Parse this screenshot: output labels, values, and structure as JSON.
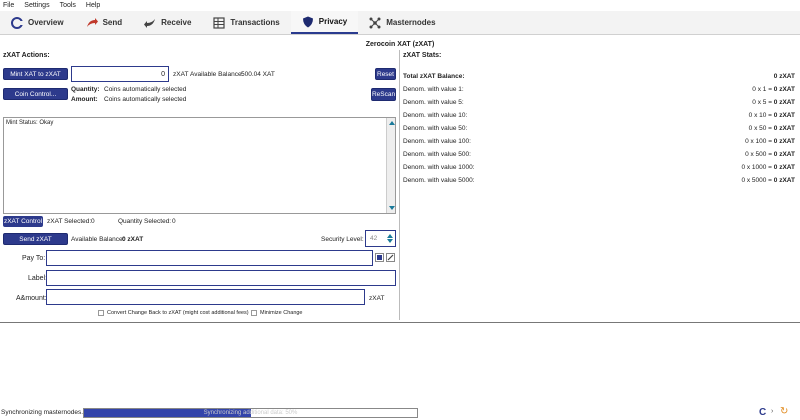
{
  "menu": [
    "File",
    "Settings",
    "Tools",
    "Help"
  ],
  "tabs": [
    {
      "label": "Overview",
      "icon": "logo-icon"
    },
    {
      "label": "Send",
      "icon": "send-arrow-icon"
    },
    {
      "label": "Receive",
      "icon": "receive-arrow-icon"
    },
    {
      "label": "Transactions",
      "icon": "transactions-icon"
    },
    {
      "label": "Privacy",
      "icon": "shield-icon"
    },
    {
      "label": "Masternodes",
      "icon": "masternodes-icon"
    }
  ],
  "active_tab": "Privacy",
  "page_title": "Zerocoin XAT (zXAT)",
  "left": {
    "section_title": "zXAT Actions:",
    "mint_button": "Mint XAT to zXAT",
    "mint_amount": "0",
    "mint_unit": "zXAT",
    "available_balance_label": "Available Balance:",
    "available_balance_value": "500.04 XAT",
    "reset_button": "Reset",
    "coin_control_button": "Coin Control...",
    "quantity_label": "Quantity:",
    "quantity_value": "Coins automatically selected",
    "amount_label": "Amount:",
    "amount_value": "Coins automatically selected",
    "rescan_button": "ReScan",
    "mint_status": "Mint Status: Okay",
    "zxat_control_button": "zXAT Control",
    "zxat_selected_label": "zXAT Selected:",
    "zxat_selected_value": "0",
    "quantity_selected_label": "Quantity Selected:",
    "quantity_selected_value": "0",
    "send_button": "Send zXAT",
    "send_available_label": "Available Balance:",
    "send_available_value": "0 zXAT",
    "security_label": "Security Level:",
    "security_value": "42",
    "pay_to_label": "Pay To:",
    "label_label": "Label:",
    "amount_field_label": "A&mount:",
    "amount_field_unit": "zXAT",
    "convert_change_label": "Convert Change Back to zXAT (might cost additional fees)",
    "minimize_change_label": "Minimize Change"
  },
  "right": {
    "section_title": "zXAT Stats:",
    "total_label": "Total zXAT Balance:",
    "total_value": "0 zXAT",
    "denoms": [
      {
        "label": "Denom. with value 1:",
        "expr": "0 x 1 = ",
        "result": "0 zXAT"
      },
      {
        "label": "Denom. with value 5:",
        "expr": "0 x 5 = ",
        "result": "0 zXAT"
      },
      {
        "label": "Denom. with value 10:",
        "expr": "0 x 10 = ",
        "result": "0 zXAT"
      },
      {
        "label": "Denom. with value 50:",
        "expr": "0 x 50 = ",
        "result": "0 zXAT"
      },
      {
        "label": "Denom. with value 100:",
        "expr": "0 x 100 = ",
        "result": "0 zXAT"
      },
      {
        "label": "Denom. with value 500:",
        "expr": "0 x 500 = ",
        "result": "0 zXAT"
      },
      {
        "label": "Denom. with value 1000:",
        "expr": "0 x 1000 = ",
        "result": "0 zXAT"
      },
      {
        "label": "Denom. with value 5000:",
        "expr": "0 x 5000 = ",
        "result": "0 zXAT"
      }
    ]
  },
  "status": {
    "sync_text": "Synchronizing masternodes...",
    "progress_text": "Synchronizing additional data: 50%",
    "progress_fraction": 0.5,
    "accent": "#2d3a8c"
  }
}
